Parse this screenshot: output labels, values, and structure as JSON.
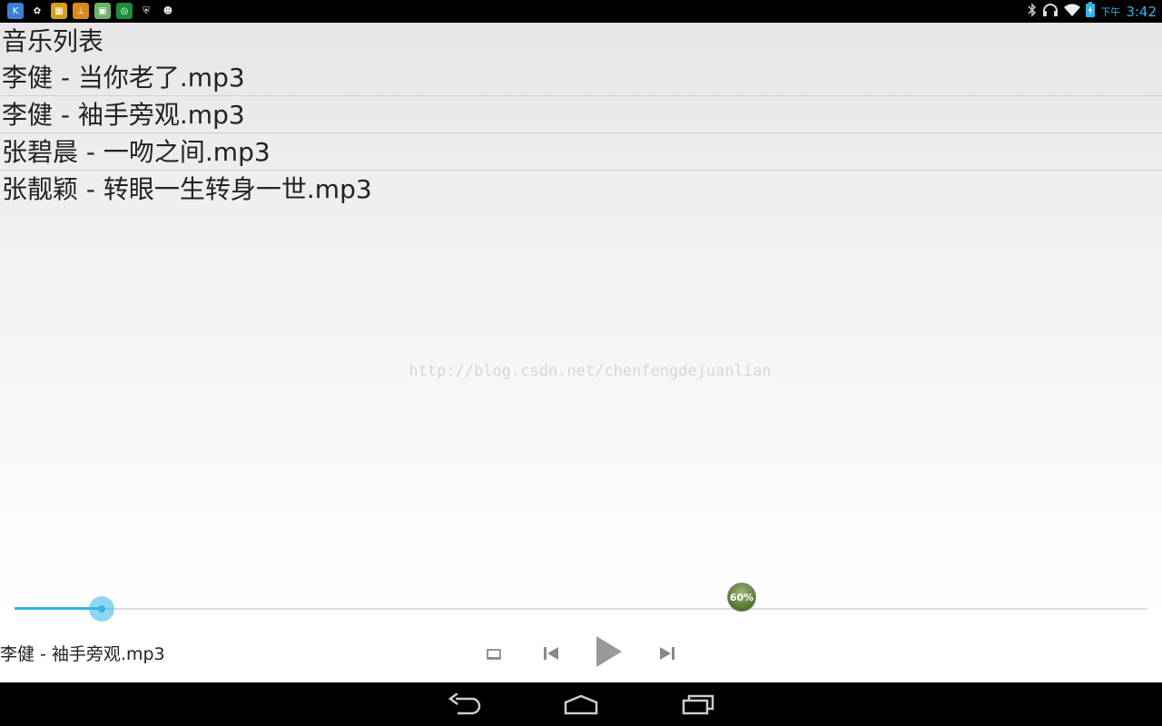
{
  "statusbar": {
    "clock_prefix": "下午",
    "clock": "3:42",
    "app_icons": [
      {
        "name": "kuaibo-icon",
        "color": "#3f7fd8",
        "glyph": "K"
      },
      {
        "name": "flower-icon",
        "color": "#000000",
        "glyph": "✿"
      },
      {
        "name": "grid-app-icon",
        "color": "#d2a21c",
        "glyph": "▦"
      },
      {
        "name": "monitor-icon",
        "color": "#d88a1b",
        "glyph": "⊥"
      },
      {
        "name": "gallery-icon",
        "color": "#6db36b",
        "glyph": "▣"
      },
      {
        "name": "download-circle-icon",
        "color": "#1a8f3a",
        "glyph": "◎"
      },
      {
        "name": "shield-icon",
        "color": "#000000",
        "glyph": "⛨"
      },
      {
        "name": "android-icon",
        "color": "#000000",
        "glyph": "☻"
      }
    ]
  },
  "music": {
    "list_title": "音乐列表",
    "songs": [
      "李健 - 当你老了.mp3",
      "李健 - 袖手旁观.mp3",
      "张碧晨 - 一吻之间.mp3",
      "张靓颖 - 转眼一生转身一世.mp3"
    ],
    "watermark": "http://blog.csdn.net/chenfengdejuanlian",
    "now_playing": "李健 - 袖手旁观.mp3",
    "progress_fraction": 0.077,
    "volume_label": "60%"
  },
  "colors": {
    "accent": "#33b5e5"
  }
}
